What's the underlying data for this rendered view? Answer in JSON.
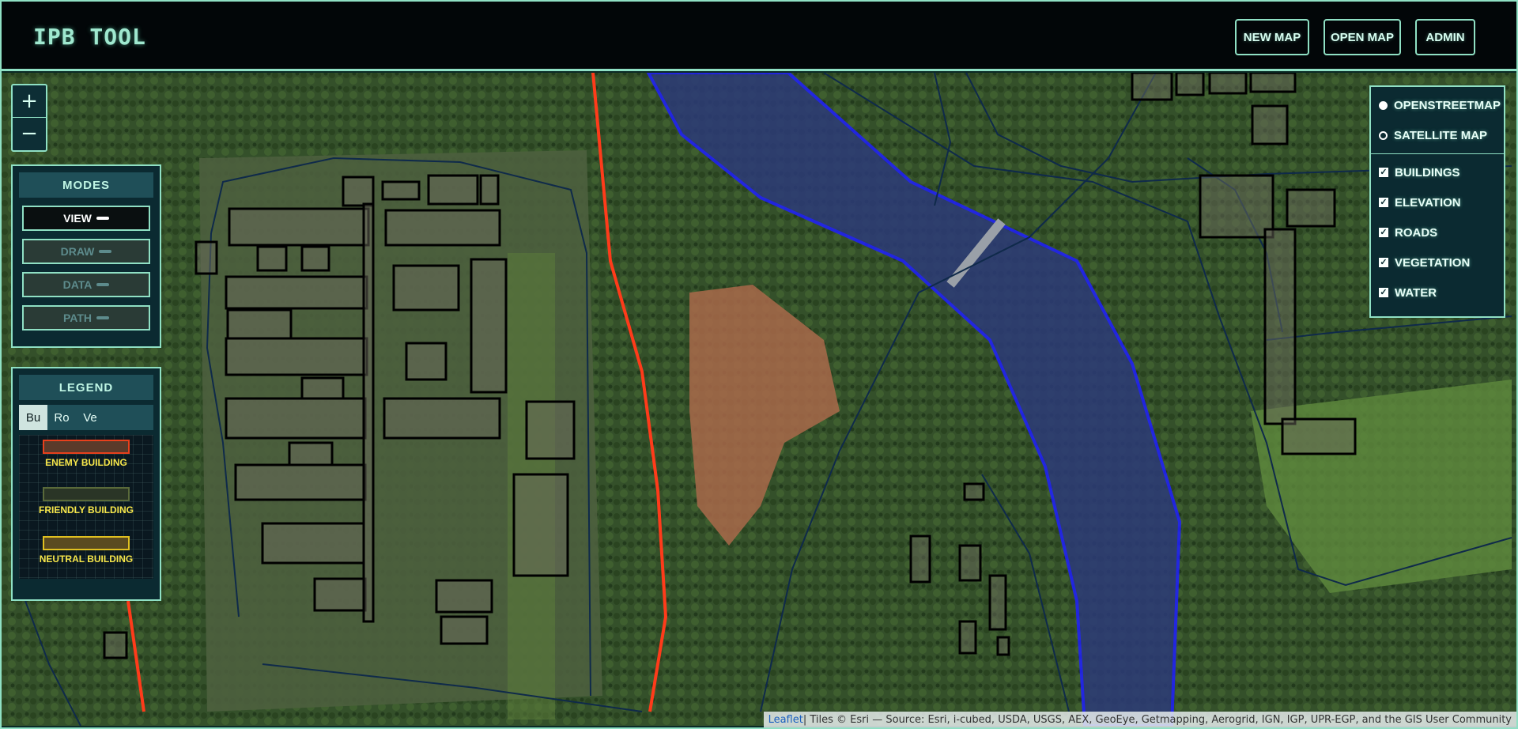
{
  "header": {
    "title": "IPB TOOL",
    "buttons": [
      "NEW MAP",
      "OPEN MAP",
      "ADMIN"
    ]
  },
  "zoom": {
    "in": "+",
    "out": "−"
  },
  "modes": {
    "title": "MODES",
    "items": [
      {
        "label": "VIEW",
        "active": true
      },
      {
        "label": "DRAW",
        "active": false
      },
      {
        "label": "DATA",
        "active": false
      },
      {
        "label": "PATH",
        "active": false
      }
    ]
  },
  "legend": {
    "title": "LEGEND",
    "tabs": [
      "Bu",
      "Ro",
      "Ve"
    ],
    "active_tab": "Bu",
    "items": [
      {
        "label": "ENEMY BUILDING",
        "border": "#e8401c",
        "fill": "#5a3a2a"
      },
      {
        "label": "FRIENDLY BUILDING",
        "border": "#5a6a3a",
        "fill": "#2a3526"
      },
      {
        "label": "NEUTRAL BUILDING",
        "border": "#e0c020",
        "fill": "#5a4a20"
      }
    ]
  },
  "layers": {
    "base": [
      {
        "label": "OPENSTREETMAP",
        "selected": true
      },
      {
        "label": "SATELLITE MAP",
        "selected": false
      }
    ],
    "overlays": [
      {
        "label": "BUILDINGS",
        "checked": true
      },
      {
        "label": "ELEVATION",
        "checked": true
      },
      {
        "label": "ROADS",
        "checked": true
      },
      {
        "label": "VEGETATION",
        "checked": true
      },
      {
        "label": "WATER",
        "checked": true
      }
    ]
  },
  "attribution": {
    "link": "Leaflet",
    "text": " | Tiles © Esri — Source: Esri, i-cubed, USDA, USGS, AEX, GeoEye, Getmapping, Aerogrid, IGN, IGP, UPR-EGP, and the GIS User Community"
  },
  "colors": {
    "accent": "#8fe0c4",
    "river_outline": "#1f1fff",
    "road_red": "#ff3b1a",
    "boundary": "#0f2a4a",
    "building_outline": "#000000"
  }
}
